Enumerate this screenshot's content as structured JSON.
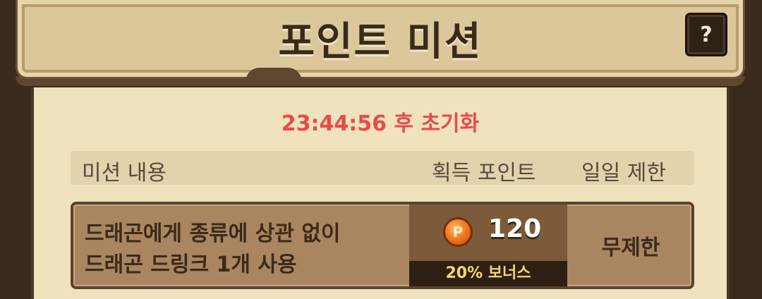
{
  "header": {
    "title": "포인트 미션",
    "help_label": "?"
  },
  "reset_timer": "23:44:56 후 초기화",
  "table": {
    "columns": [
      "미션 내용",
      "획득 포인트",
      "일일 제한"
    ],
    "rows": [
      {
        "mission_line1": "드래곤에게 종류에 상관 없이",
        "mission_line2": "드래곤 드링크 1개 사용",
        "points": "120",
        "bonus": "20% 보너스",
        "limit": "무제한"
      }
    ]
  },
  "colors": {
    "timer": "#e84a4a",
    "panel": "#efe2bd",
    "header": "#dcc79a",
    "bonus_text": "#f5d86a"
  },
  "icons": {
    "coin": "point-coin-icon"
  },
  "coin_letter": "P"
}
